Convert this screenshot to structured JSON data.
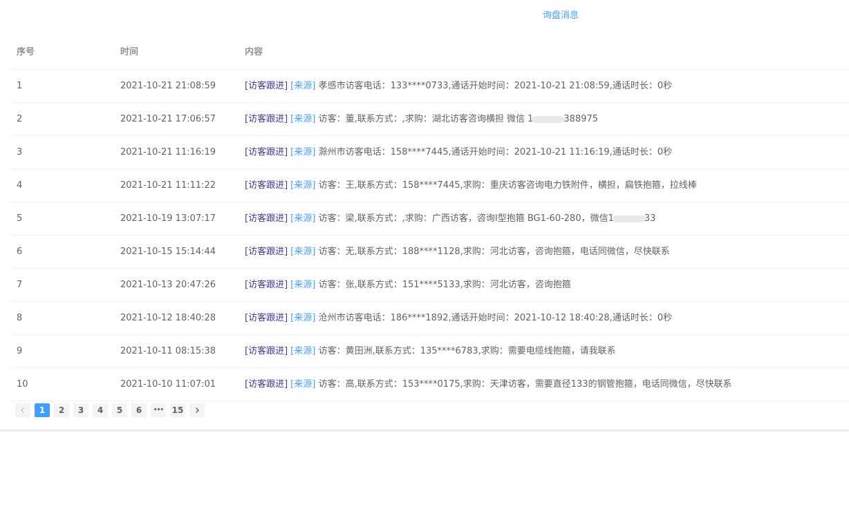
{
  "tab": {
    "title": "询盘消息"
  },
  "table": {
    "headers": {
      "index": "序号",
      "time": "时间",
      "content": "内容"
    },
    "follow_label": "[访客跟进]",
    "source_label": "[来源]",
    "rows": [
      {
        "index": "1",
        "time": "2021-10-21 21:08:59",
        "content": "孝感市访客电话：133****0733,通话开始时间：2021-10-21 21:08:59,通话时长：0秒"
      },
      {
        "index": "2",
        "time": "2021-10-21 17:06:57",
        "content": "访客：董,联系方式：,求购：湖北访客咨询横担 微信 1",
        "content_tail": "388975"
      },
      {
        "index": "3",
        "time": "2021-10-21 11:16:19",
        "content": "滁州市访客电话：158****7445,通话开始时间：2021-10-21 11:16:19,通话时长：0秒"
      },
      {
        "index": "4",
        "time": "2021-10-21 11:11:22",
        "content": "访客：王,联系方式：158****7445,求购：重庆访客咨询电力铁附件，横担，扁铁抱箍，拉线棒"
      },
      {
        "index": "5",
        "time": "2021-10-19 13:07:17",
        "content": "访客：梁,联系方式：,求购：广西访客，咨询I型抱箍 BG1-60-280，微信1",
        "content_tail": "33"
      },
      {
        "index": "6",
        "time": "2021-10-15 15:14:44",
        "content": "访客：无,联系方式：188****1128,求购：河北访客，咨询抱箍，电话同微信，尽快联系"
      },
      {
        "index": "7",
        "time": "2021-10-13 20:47:26",
        "content": "访客：张,联系方式：151****5133,求购：河北访客，咨询抱箍"
      },
      {
        "index": "8",
        "time": "2021-10-12 18:40:28",
        "content": "沧州市访客电话：186****1892,通话开始时间：2021-10-12 18:40:28,通话时长：0秒"
      },
      {
        "index": "9",
        "time": "2021-10-11 08:15:38",
        "content": "访客：黄田洲,联系方式：135****6783,求购：需要电缆线抱箍，请我联系"
      },
      {
        "index": "10",
        "time": "2021-10-10 11:07:01",
        "content": "访客：高,联系方式：153****0175,求购：天津访客，需要直径133的钢管抱箍，电话同微信，尽快联系"
      }
    ]
  },
  "pagination": {
    "pages": [
      "1",
      "2",
      "3",
      "4",
      "5",
      "6"
    ],
    "ellipsis": "•••",
    "last_page": "15",
    "current": "1",
    "prev_icon": "chevron-left-icon",
    "next_icon": "chevron-right-icon"
  },
  "colors": {
    "accent": "#409eff",
    "follow_link": "#3a3a9e",
    "border": "#ebeef5"
  }
}
